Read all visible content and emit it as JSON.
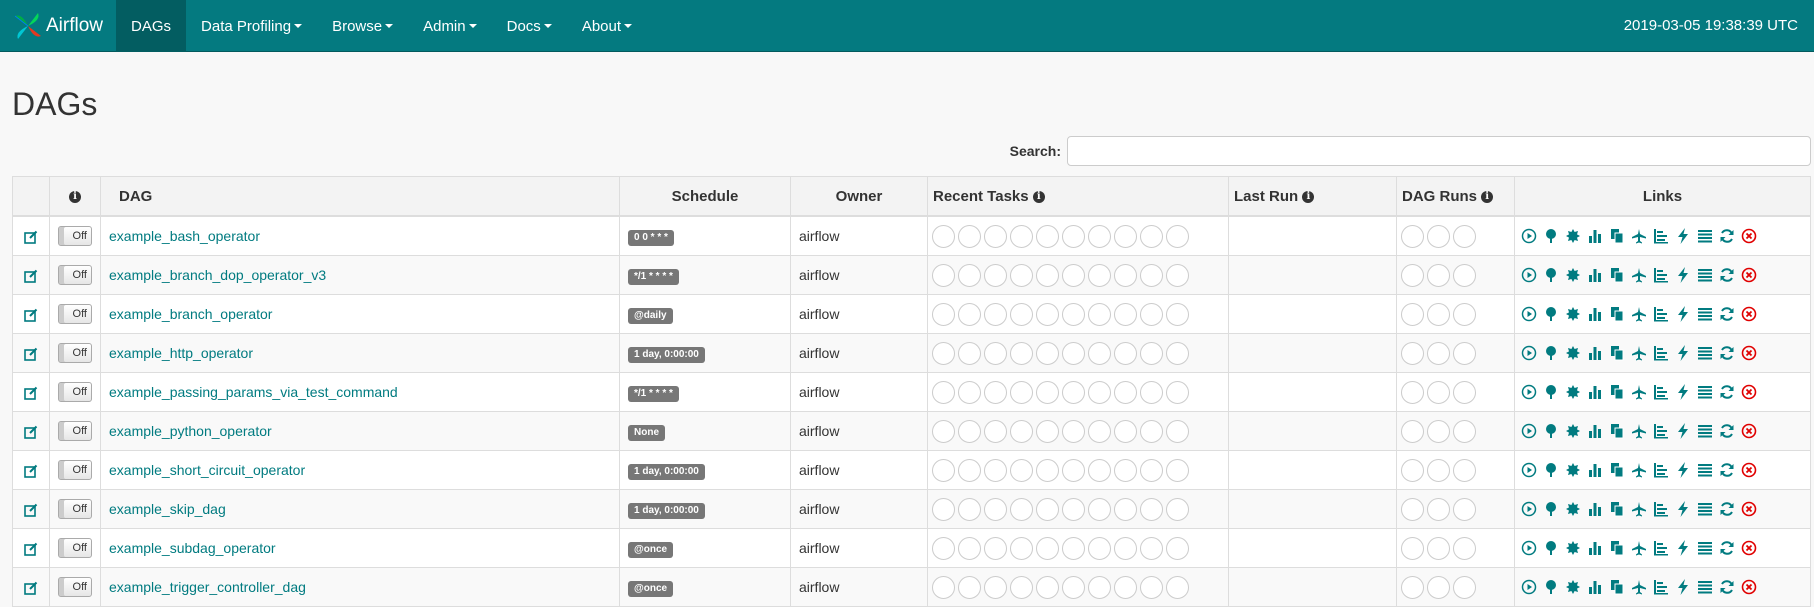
{
  "navbar": {
    "brand": "Airflow",
    "items": [
      {
        "label": "DAGs",
        "active": true,
        "dropdown": false
      },
      {
        "label": "Data Profiling",
        "active": false,
        "dropdown": true
      },
      {
        "label": "Browse",
        "active": false,
        "dropdown": true
      },
      {
        "label": "Admin",
        "active": false,
        "dropdown": true
      },
      {
        "label": "Docs",
        "active": false,
        "dropdown": true
      },
      {
        "label": "About",
        "active": false,
        "dropdown": true
      }
    ],
    "clock": "2019-03-05 19:38:39 UTC"
  },
  "page": {
    "title": "DAGs"
  },
  "search": {
    "label": "Search:",
    "value": ""
  },
  "table": {
    "headers": {
      "dag": "DAG",
      "schedule": "Schedule",
      "owner": "Owner",
      "recent_tasks": "Recent Tasks",
      "last_run": "Last Run",
      "dag_runs": "DAG Runs",
      "links": "Links"
    },
    "toggle_label": "Off",
    "rows": [
      {
        "dag": "example_bash_operator",
        "schedule": "0 0 * * *",
        "owner": "airflow"
      },
      {
        "dag": "example_branch_dop_operator_v3",
        "schedule": "*/1 * * * *",
        "owner": "airflow"
      },
      {
        "dag": "example_branch_operator",
        "schedule": "@daily",
        "owner": "airflow"
      },
      {
        "dag": "example_http_operator",
        "schedule": "1 day, 0:00:00",
        "owner": "airflow"
      },
      {
        "dag": "example_passing_params_via_test_command",
        "schedule": "*/1 * * * *",
        "owner": "airflow"
      },
      {
        "dag": "example_python_operator",
        "schedule": "None",
        "owner": "airflow"
      },
      {
        "dag": "example_short_circuit_operator",
        "schedule": "1 day, 0:00:00",
        "owner": "airflow"
      },
      {
        "dag": "example_skip_dag",
        "schedule": "1 day, 0:00:00",
        "owner": "airflow"
      },
      {
        "dag": "example_subdag_operator",
        "schedule": "@once",
        "owner": "airflow"
      },
      {
        "dag": "example_trigger_controller_dag",
        "schedule": "@once",
        "owner": "airflow"
      }
    ],
    "recent_task_circles": 10,
    "dag_run_circles": 3,
    "link_icons": [
      "trigger-dag-icon",
      "tree-view-icon",
      "graph-view-icon",
      "duration-icon",
      "task-tries-icon",
      "landing-times-icon",
      "gantt-icon",
      "code-icon",
      "logs-icon",
      "refresh-icon",
      "delete-icon"
    ]
  },
  "colors": {
    "navbar": "#047a80",
    "accent": "#017b80",
    "delete": "#e00000"
  }
}
